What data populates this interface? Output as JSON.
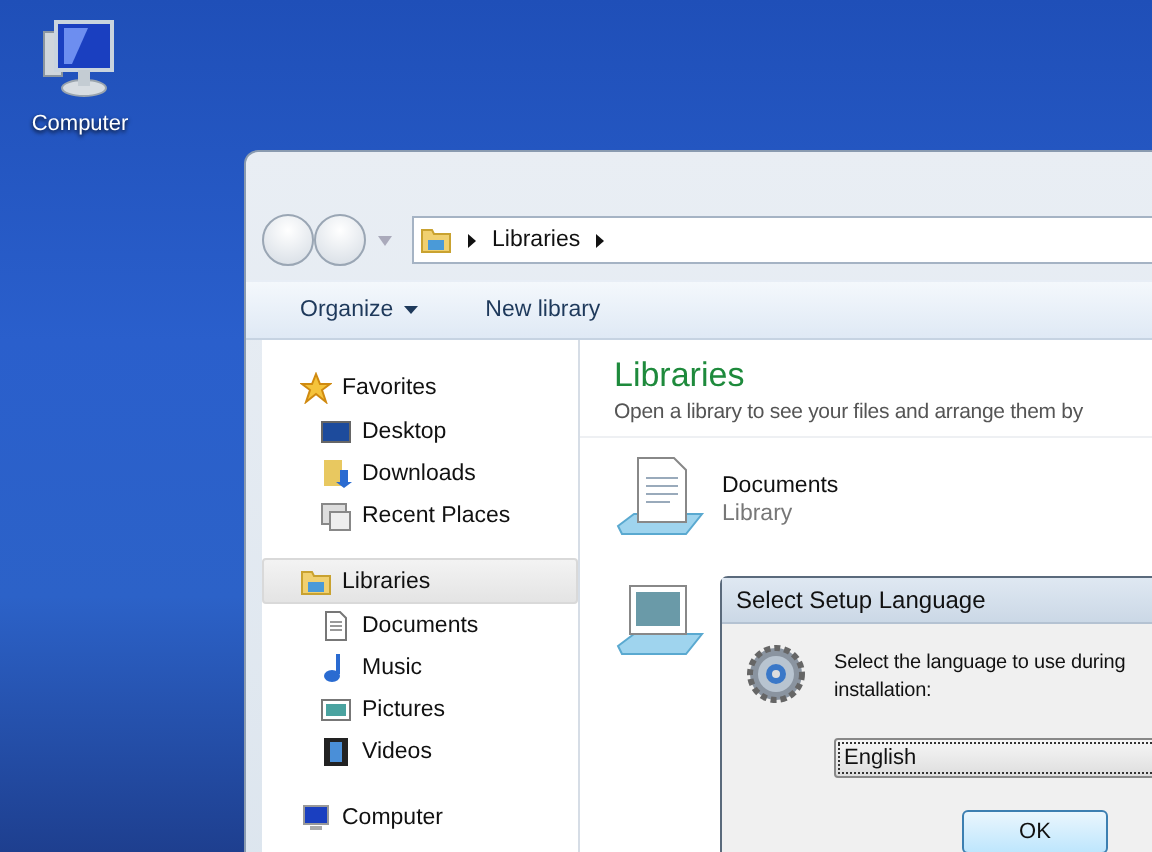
{
  "desktop_icons": [
    {
      "label": "Computer"
    }
  ],
  "explorer": {
    "breadcrumb": [
      "Libraries"
    ],
    "toolbar": [
      {
        "label": "Organize",
        "kind": "menu"
      },
      {
        "label": "New library",
        "kind": "plain"
      }
    ],
    "sidebar": [
      {
        "label": "Favorites",
        "selected": false,
        "children": [
          {
            "label": "Desktop"
          },
          {
            "label": "Downloads"
          },
          {
            "label": "Recent Places"
          }
        ]
      },
      {
        "label": "Libraries",
        "selected": true,
        "children": [
          {
            "label": "Documents"
          },
          {
            "label": "Music"
          },
          {
            "label": "Pictures"
          },
          {
            "label": "Videos"
          }
        ]
      },
      {
        "label": "Computer",
        "selected": false
      }
    ],
    "content": {
      "title": "Libraries",
      "subtitle": "Open a library to see your files and arrange them by",
      "libraries": [
        {
          "name": "Documents",
          "caption": "Library"
        }
      ]
    }
  },
  "dialog": {
    "title": "Select Setup Language",
    "message": "Select the language to use during installation:",
    "language": "English",
    "button": "OK"
  }
}
